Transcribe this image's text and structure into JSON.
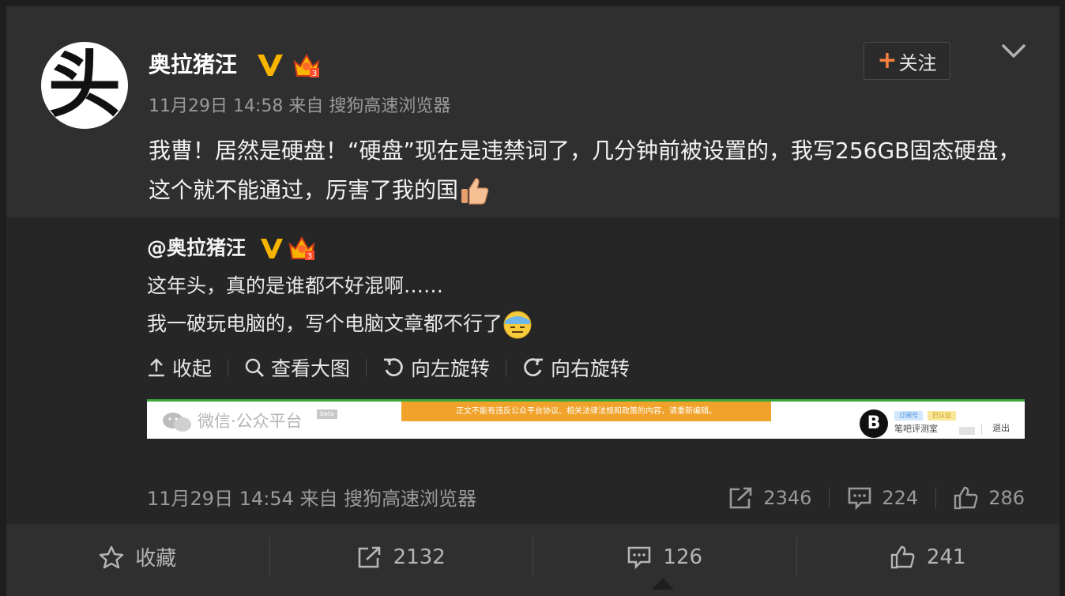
{
  "post": {
    "avatar_char": "头",
    "username": "奥拉猪汪",
    "follow_label": "关注",
    "follow_plus": "+",
    "meta": "11月29日 14:58 来自 搜狗高速浏览器",
    "text": "我曹！居然是硬盘！“硬盘”现在是违禁词了，几分钟前被设置的，我写256GB固态硬盘，这个就不能通过，厉害了我的国"
  },
  "repost": {
    "username": "@奥拉猪汪",
    "line1": "这年头，真的是谁都不好混啊……",
    "line2": "我一破玩电脑的，写个电脑文章都不行了",
    "actions": {
      "collapse": "收起",
      "view_large": "查看大图",
      "rotate_left": "向左旋转",
      "rotate_right": "向右旋转"
    },
    "wechat": {
      "title": "微信·公众平台",
      "tag": "beta",
      "warning": "正文不能有违反公众平台协议、相关法律法规和政策的内容，请重新编辑。",
      "account_logo": "B",
      "chip1": "订阅号",
      "chip2": "已认证",
      "account_name": "笔吧评测室",
      "exit": "退出"
    },
    "meta": "11月29日 14:54 来自 搜狗高速浏览器",
    "stats": {
      "reposts": "2346",
      "comments": "224",
      "likes": "286"
    }
  },
  "bottom": {
    "favorite": "收藏",
    "reposts": "2132",
    "comments": "126",
    "likes": "241"
  },
  "colors": {
    "accent_orange": "#ff8140",
    "badge_gold": "#f7b500",
    "wechat_green": "#3aa63a",
    "warning_orange": "#f0a22a"
  }
}
